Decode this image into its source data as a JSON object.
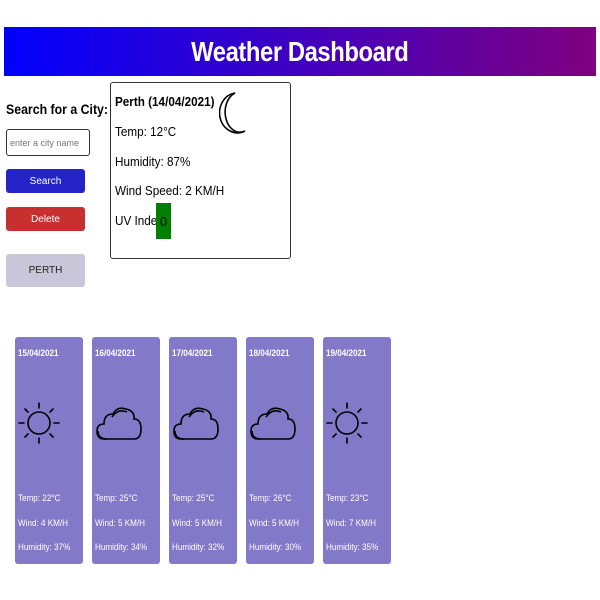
{
  "header": {
    "title": "Weather Dashboard"
  },
  "search": {
    "title": "Search for a City:",
    "placeholder": "enter a city name",
    "value": "",
    "search_label": "Search",
    "delete_label": "Delete",
    "history": [
      "PERTH"
    ]
  },
  "current": {
    "title": "Perth (14/04/2021)",
    "icon": "moon-icon",
    "temp": "Temp: 12°C",
    "humidity": "Humidity: 87%",
    "wind": "Wind Speed: 2 KM/H",
    "uv_label": "UV Index:",
    "uv_value": "0",
    "uv_color": "#008000"
  },
  "forecast": [
    {
      "date": "15/04/2021",
      "icon": "sun-icon",
      "temp": "Temp: 22°C",
      "wind": "Wind: 4 KM/H",
      "humidity": "Humidity: 37%"
    },
    {
      "date": "16/04/2021",
      "icon": "cloud-icon",
      "temp": "Temp: 25°C",
      "wind": "Wind: 5 KM/H",
      "humidity": "Humidity: 34%"
    },
    {
      "date": "17/04/2021",
      "icon": "cloud-icon",
      "temp": "Temp: 25°C",
      "wind": "Wind: 5 KM/H",
      "humidity": "Humidity: 32%"
    },
    {
      "date": "18/04/2021",
      "icon": "cloud-icon",
      "temp": "Temp: 26°C",
      "wind": "Wind: 5 KM/H",
      "humidity": "Humidity: 30%"
    },
    {
      "date": "19/04/2021",
      "icon": "sun-icon",
      "temp": "Temp: 23°C",
      "wind": "Wind: 7 KM/H",
      "humidity": "Humidity: 35%"
    }
  ],
  "colors": {
    "header_gradient_start": "#0000ff",
    "header_gradient_end": "#800080",
    "card_bg": "#8279c9",
    "search_button": "#2323c8",
    "delete_button": "#c83030",
    "history_button": "#c8c6d8"
  }
}
